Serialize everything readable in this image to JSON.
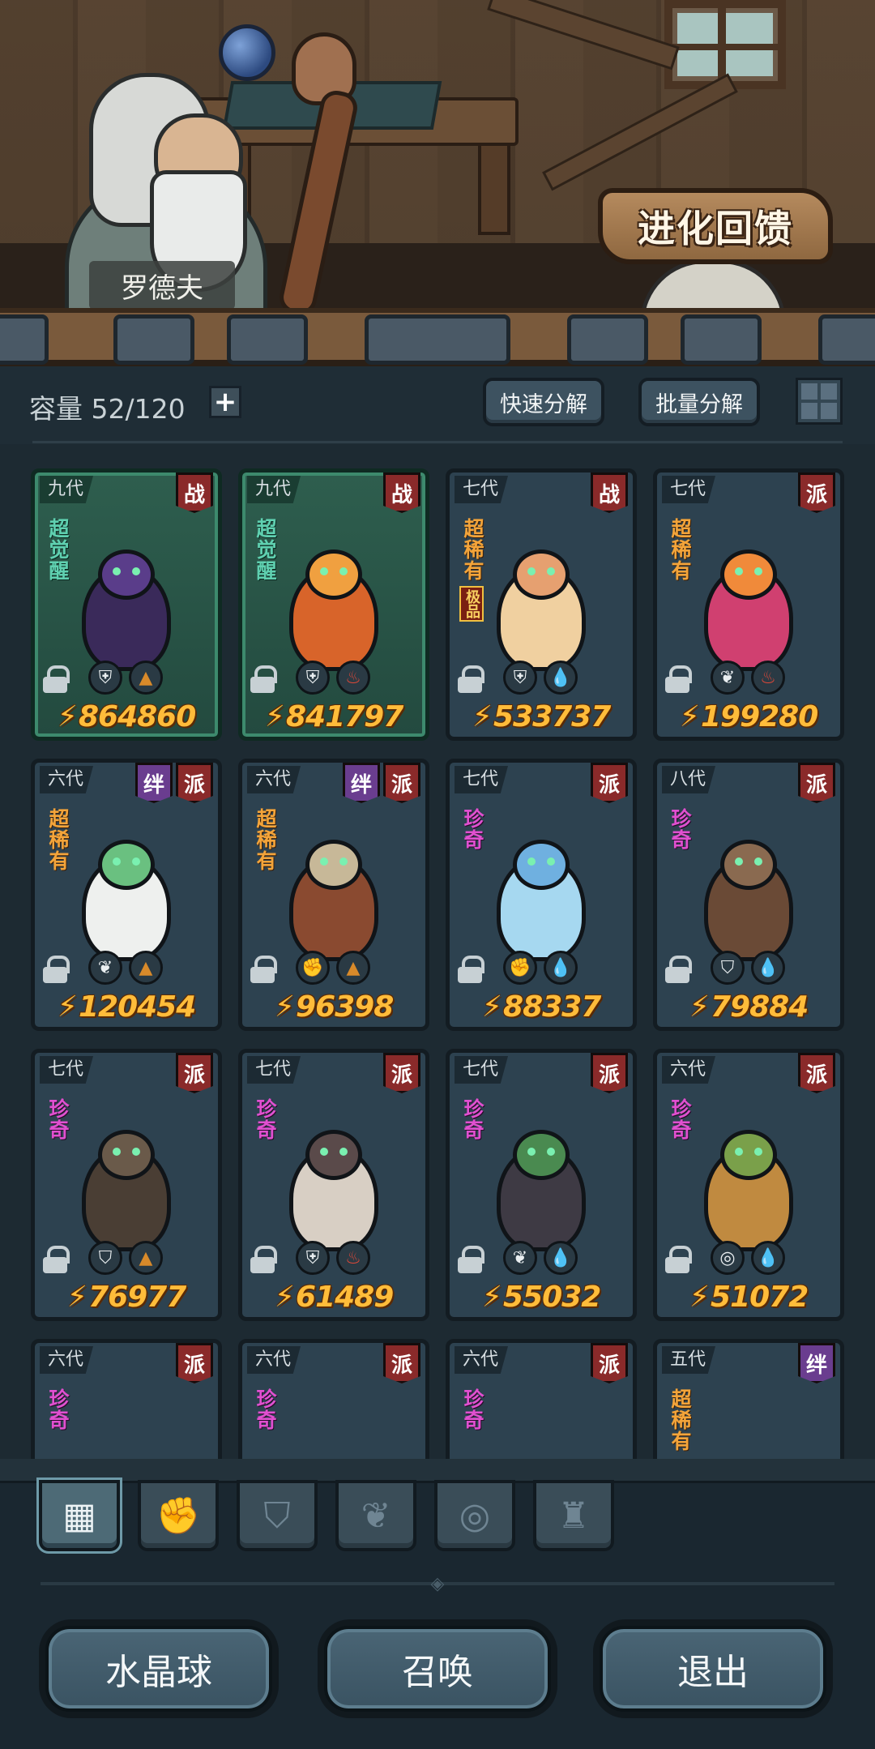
{
  "npc": {
    "name": "罗德夫"
  },
  "evolution_button": {
    "label": "进化回馈"
  },
  "storage": {
    "label": "容量",
    "count": "52/120"
  },
  "actions": {
    "quick_dismantle": "快速分解",
    "batch_dismantle": "批量分解"
  },
  "cards": [
    {
      "gen": "九代",
      "tags": [
        "战"
      ],
      "rarity": "超觉醒",
      "extra": "",
      "attrs": [
        "shield-class-icon",
        "earth-element-icon"
      ],
      "power": "864860",
      "awakened": true
    },
    {
      "gen": "九代",
      "tags": [
        "战"
      ],
      "rarity": "超觉醒",
      "extra": "",
      "attrs": [
        "shield-class-icon",
        "fire-element-icon"
      ],
      "power": "841797",
      "awakened": true
    },
    {
      "gen": "七代",
      "tags": [
        "战"
      ],
      "rarity": "超稀有",
      "extra": "极品",
      "attrs": [
        "shield-class-icon",
        "water-element-icon"
      ],
      "power": "533737",
      "awakened": false
    },
    {
      "gen": "七代",
      "tags": [
        "派"
      ],
      "rarity": "超稀有",
      "extra": "",
      "attrs": [
        "leaf-class-icon",
        "fire-element-icon"
      ],
      "power": "199280",
      "awakened": false
    },
    {
      "gen": "六代",
      "tags": [
        "绊",
        "派"
      ],
      "rarity": "超稀有",
      "extra": "",
      "attrs": [
        "leaf-class-icon",
        "earth-element-icon"
      ],
      "power": "120454",
      "awakened": false
    },
    {
      "gen": "六代",
      "tags": [
        "绊",
        "派"
      ],
      "rarity": "超稀有",
      "extra": "",
      "attrs": [
        "fist-class-icon",
        "earth-element-icon"
      ],
      "power": "96398",
      "awakened": false
    },
    {
      "gen": "七代",
      "tags": [
        "派"
      ],
      "rarity": "珍奇",
      "extra": "",
      "attrs": [
        "fist-class-icon",
        "water-element-icon"
      ],
      "power": "88337",
      "awakened": false
    },
    {
      "gen": "八代",
      "tags": [
        "派"
      ],
      "rarity": "珍奇",
      "extra": "",
      "attrs": [
        "winged-shield-class-icon",
        "water-element-icon"
      ],
      "power": "79884",
      "awakened": false
    },
    {
      "gen": "七代",
      "tags": [
        "派"
      ],
      "rarity": "珍奇",
      "extra": "",
      "attrs": [
        "winged-shield-class-icon",
        "earth-element-icon"
      ],
      "power": "76977",
      "awakened": false
    },
    {
      "gen": "七代",
      "tags": [
        "派"
      ],
      "rarity": "珍奇",
      "extra": "",
      "attrs": [
        "shield-class-icon",
        "fire-element-icon"
      ],
      "power": "61489",
      "awakened": false
    },
    {
      "gen": "七代",
      "tags": [
        "派"
      ],
      "rarity": "珍奇",
      "extra": "",
      "attrs": [
        "leaf-class-icon",
        "water-element-icon"
      ],
      "power": "55032",
      "awakened": false
    },
    {
      "gen": "六代",
      "tags": [
        "派"
      ],
      "rarity": "珍奇",
      "extra": "",
      "attrs": [
        "alien-class-icon",
        "water-element-icon"
      ],
      "power": "51072",
      "awakened": false
    },
    {
      "gen": "六代",
      "tags": [
        "派"
      ],
      "rarity": "珍奇",
      "extra": "",
      "attrs": [],
      "power": "",
      "awakened": false
    },
    {
      "gen": "六代",
      "tags": [
        "派"
      ],
      "rarity": "珍奇",
      "extra": "",
      "attrs": [],
      "power": "",
      "awakened": false
    },
    {
      "gen": "六代",
      "tags": [
        "派"
      ],
      "rarity": "珍奇",
      "extra": "",
      "attrs": [],
      "power": "",
      "awakened": false
    },
    {
      "gen": "五代",
      "tags": [
        "绊"
      ],
      "rarity": "超稀有",
      "extra": "",
      "attrs": [],
      "power": "",
      "awakened": false
    }
  ],
  "filter_tabs": [
    {
      "icon": "all-blocks-icon",
      "active": true
    },
    {
      "icon": "fist-icon",
      "active": false
    },
    {
      "icon": "winged-shield-icon",
      "active": false
    },
    {
      "icon": "leaf-icon",
      "active": false
    },
    {
      "icon": "alien-icon",
      "active": false
    },
    {
      "icon": "flame-crest-icon",
      "active": false
    }
  ],
  "bottom_buttons": {
    "crystal_ball": "水晶球",
    "summon": "召唤",
    "exit": "退出"
  },
  "colors": {
    "power_gold": "#ffbc3a",
    "tag_red": "#8a2a2a",
    "tag_purple": "#6a3d8f",
    "rarity_orange": "#f3a43a",
    "rarity_magenta": "#e050d0",
    "awakened_green": "#2e5e4e"
  }
}
